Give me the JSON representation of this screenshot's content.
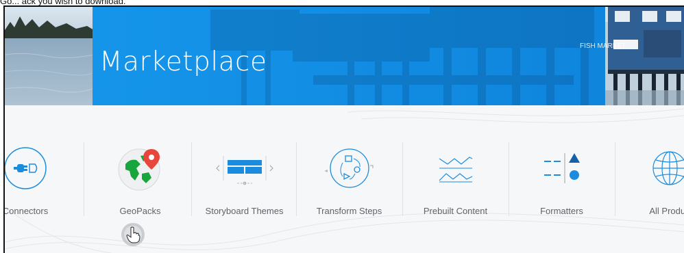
{
  "caption": "Go... ack you wish to download.",
  "banner": {
    "title": "Marketplace",
    "sign_text": "FISH MARKET"
  },
  "categories": [
    {
      "label": "Connectors",
      "icon": "connector-plug-icon"
    },
    {
      "label": "GeoPacks",
      "icon": "globe-map-pin-icon"
    },
    {
      "label": "Storyboard Themes",
      "icon": "storyboard-carousel-icon"
    },
    {
      "label": "Transform Steps",
      "icon": "transform-cycle-icon"
    },
    {
      "label": "Prebuilt Content",
      "icon": "line-chart-icon"
    },
    {
      "label": "Formatters",
      "icon": "formatter-shapes-icon"
    },
    {
      "label": "All Produc",
      "icon": "globe-grid-icon"
    }
  ],
  "cursor": {
    "icon": "hand-pointer-cursor-icon"
  },
  "colors": {
    "accent_blue": "#1592e6",
    "icon_blue": "#1a8ce0",
    "label_gray": "#5f6368",
    "pin_red": "#e8453c",
    "globe_green": "#18a53c"
  }
}
